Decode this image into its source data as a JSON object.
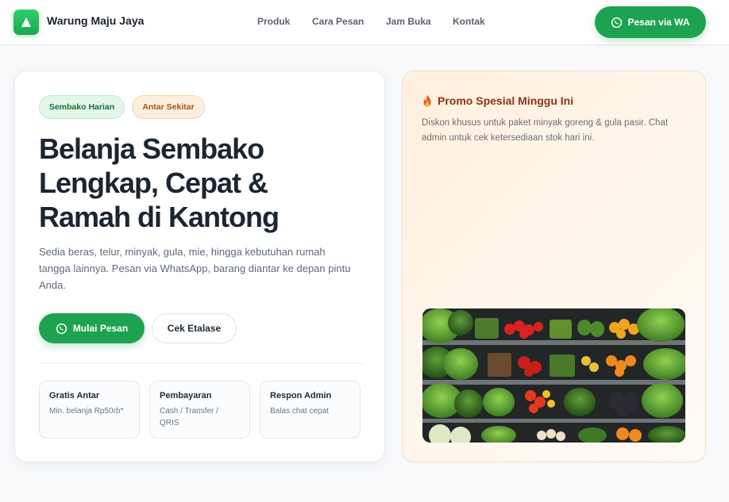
{
  "header": {
    "brand": "Warung Maju Jaya",
    "nav": [
      "Produk",
      "Cara Pesan",
      "Jam Buka",
      "Kontak"
    ],
    "cta": "Pesan via WA"
  },
  "hero": {
    "tags": [
      "Sembako Harian",
      "Antar Sekitar"
    ],
    "title_lines": [
      "Belanja Sembako",
      "Lengkap, Cepat &",
      "Ramah di Kantong"
    ],
    "description": "Sedia beras, telur, minyak, gula, mie, hingga kebutuhan rumah tangga lainnya. Pesan via WhatsApp, barang diantar ke depan pintu Anda.",
    "primary_button": "Mulai Pesan",
    "secondary_button": "Cek Etalase",
    "features": [
      {
        "title": "Gratis Antar",
        "subtitle": "Min. belanja Rp50rb*"
      },
      {
        "title": "Pembayaran",
        "subtitle": "Cash / Transfer / QRIS"
      },
      {
        "title": "Respon Admin",
        "subtitle": "Balas chat cepat"
      }
    ]
  },
  "promo": {
    "icon": "fire-icon",
    "title": "Promo Spesial Minggu Ini",
    "description": "Diskon khusus untuk paket minyak goreng & gula pasir. Chat admin untuk cek ketersediaan stok hari ini.",
    "image": "produce-shelf-image"
  },
  "colors": {
    "brand_green": "#1da34f",
    "promo_text": "#8a3512",
    "tag_green_bg": "#e3f7e8",
    "tag_orange_bg": "#fdeedd"
  }
}
